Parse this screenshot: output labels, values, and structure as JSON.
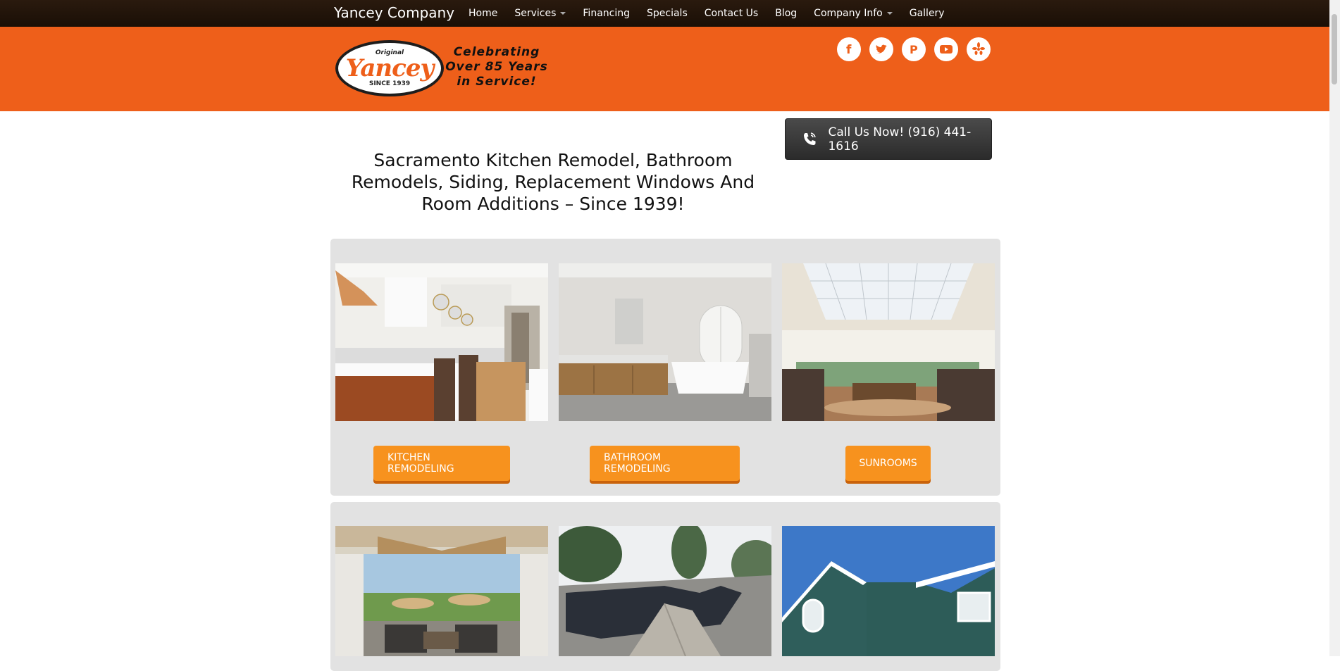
{
  "brand": "Yancey Company",
  "nav": {
    "items": [
      {
        "label": "Home"
      },
      {
        "label": "Services",
        "dropdown": true
      },
      {
        "label": "Financing"
      },
      {
        "label": "Specials"
      },
      {
        "label": "Contact Us"
      },
      {
        "label": "Blog"
      },
      {
        "label": "Company Info",
        "dropdown": true
      },
      {
        "label": "Gallery"
      }
    ]
  },
  "logo": {
    "small": "Original",
    "name": "Yancey",
    "since": "SINCE 1939"
  },
  "tagline": {
    "line1": "Celebrating",
    "line2": "Over 85 Years",
    "line3": "in Service!"
  },
  "social": [
    "facebook-icon",
    "twitter-icon",
    "pinterest-icon",
    "youtube-icon",
    "yelp-icon"
  ],
  "call": {
    "label": "Call Us Now! (916) 441-1616"
  },
  "headline": "Sacramento Kitchen Remodel, Bathroom Remodels, Siding, Replacement Windows And Room Additions – Since 1939!",
  "services": [
    {
      "label": "KITCHEN REMODELING"
    },
    {
      "label": "BATHROOM REMODELING"
    },
    {
      "label": "SUNROOMS"
    }
  ],
  "colors": {
    "header": "#ee5f1a",
    "nav": "#1a0f06",
    "button": "#f7921e",
    "panel": "#e2e2e2"
  }
}
